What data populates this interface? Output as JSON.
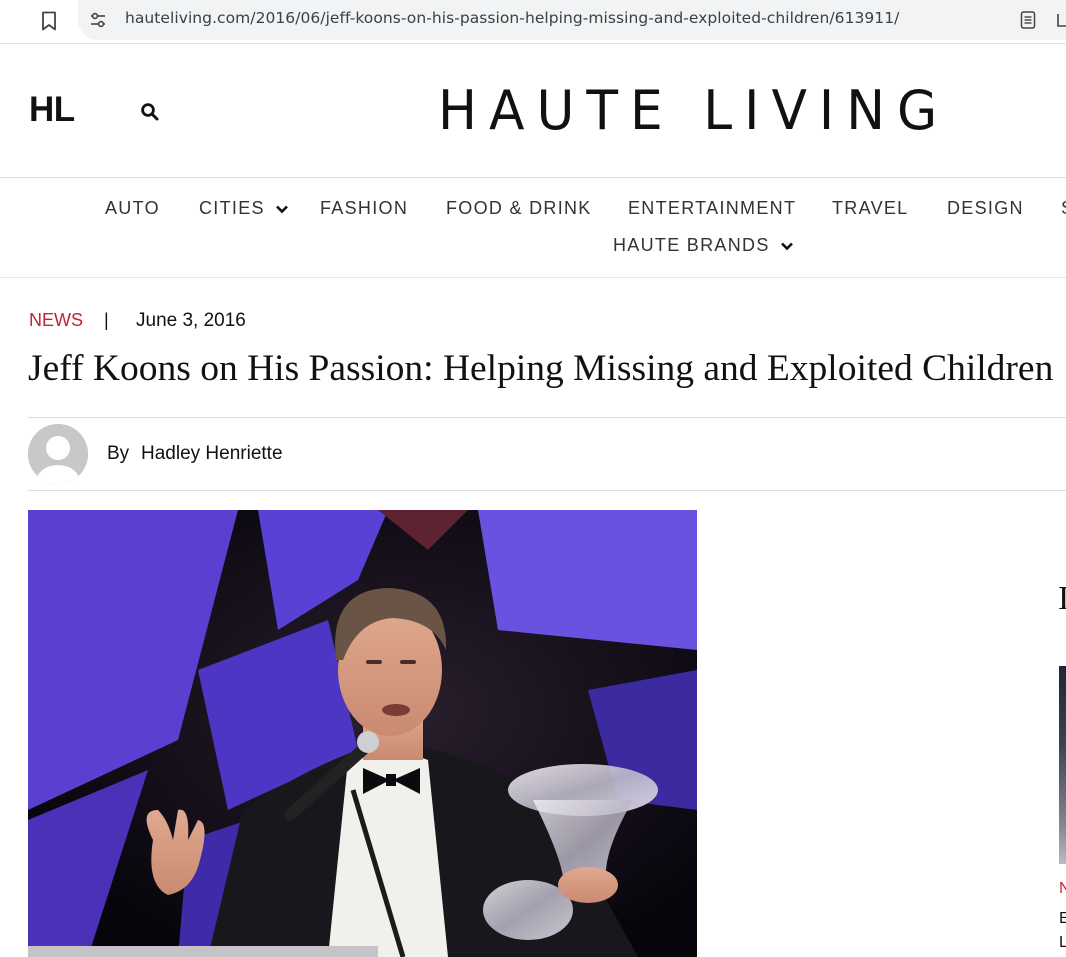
{
  "browser": {
    "url": "hauteliving.com/2016/06/jeff-koons-on-his-passion-helping-missing-and-exploited-children/613911/"
  },
  "header": {
    "short_logo": "HL",
    "brand": "HAUTE LIVING"
  },
  "nav": {
    "items": [
      {
        "label": "AUTO"
      },
      {
        "label": "CITIES"
      },
      {
        "label": "FASHION"
      },
      {
        "label": "FOOD & DRINK"
      },
      {
        "label": "ENTERTAINMENT"
      },
      {
        "label": "TRAVEL"
      },
      {
        "label": "DESIGN"
      },
      {
        "label": "S"
      },
      {
        "label": "HAUTE BRANDS"
      }
    ]
  },
  "article": {
    "category": "NEWS",
    "separator": "|",
    "date": "June 3, 2016",
    "title": "Jeff Koons on His Passion: Helping Missing and Exploited Children",
    "by_label": "By",
    "author": "Hadley Henriette"
  },
  "sidebar": {
    "heading_fragment": "I",
    "category_fragment": "N",
    "line1_fragment": "E",
    "line2_fragment": "L"
  },
  "colors": {
    "accent_red": "#c0252b",
    "url_bar_bg": "#f1f3f4"
  },
  "icons": {
    "bookmark": "bookmark-icon",
    "site_info": "site-info-icon",
    "reader": "reader-mode-icon",
    "search": "search-icon",
    "chevron": "chevron-down-icon"
  }
}
